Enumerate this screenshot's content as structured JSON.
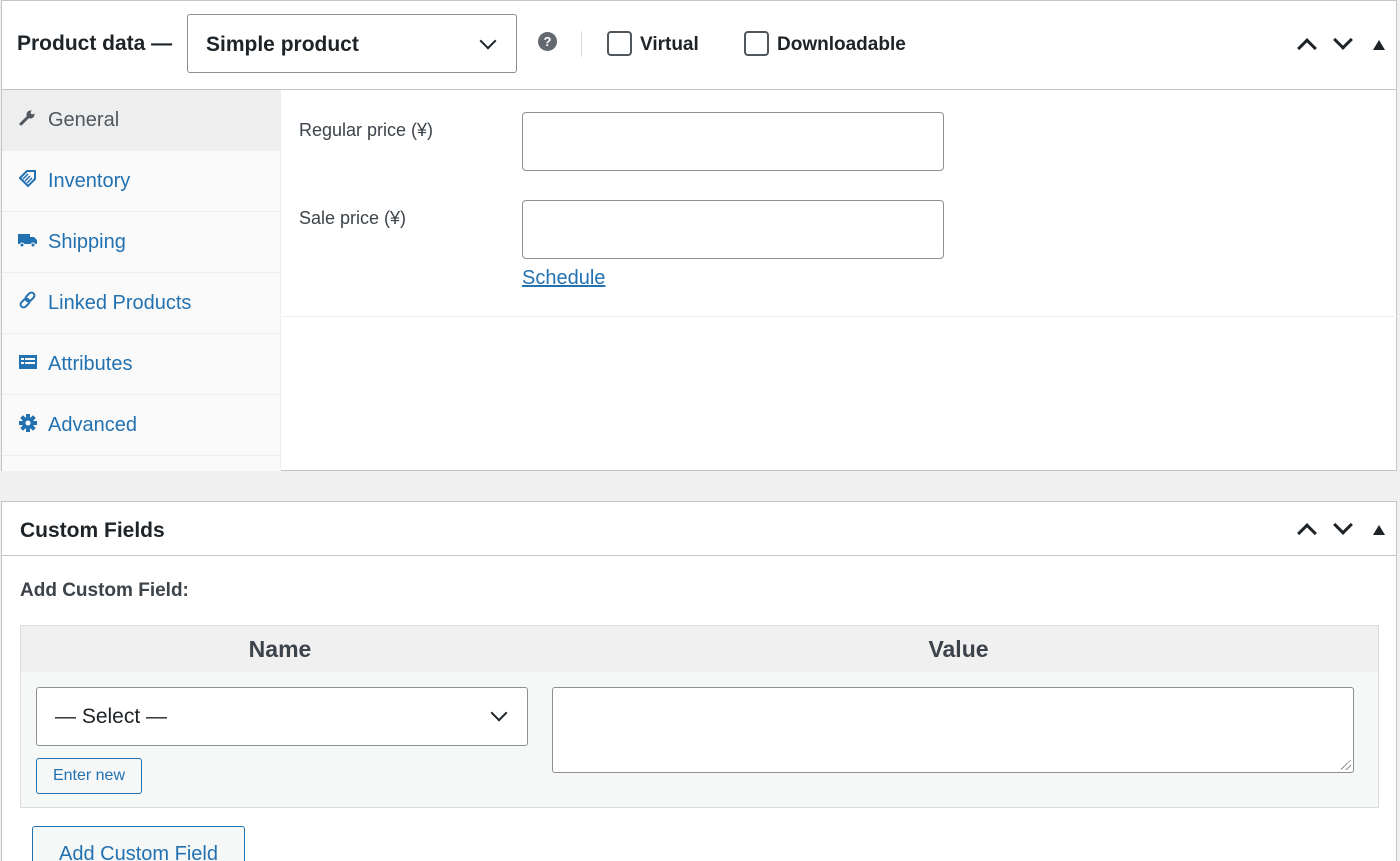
{
  "product_data": {
    "title": "Product data —",
    "product_type": "Simple product",
    "help_glyph": "?",
    "virtual_label": "Virtual",
    "virtual_checked": false,
    "downloadable_label": "Downloadable",
    "downloadable_checked": false,
    "tabs": [
      {
        "label": "General",
        "icon": "wrench-icon",
        "active": true
      },
      {
        "label": "Inventory",
        "icon": "tag-icon",
        "active": false
      },
      {
        "label": "Shipping",
        "icon": "truck-icon",
        "active": false
      },
      {
        "label": "Linked Products",
        "icon": "link-icon",
        "active": false
      },
      {
        "label": "Attributes",
        "icon": "list-icon",
        "active": false
      },
      {
        "label": "Advanced",
        "icon": "gear-icon",
        "active": false
      }
    ],
    "general": {
      "regular_price_label": "Regular price (¥)",
      "regular_price_value": "",
      "sale_price_label": "Sale price (¥)",
      "sale_price_value": "",
      "schedule_link": "Schedule"
    }
  },
  "custom_fields": {
    "title": "Custom Fields",
    "add_label": "Add Custom Field:",
    "name_header": "Name",
    "value_header": "Value",
    "name_select": "— Select —",
    "value": "",
    "enter_new_label": "Enter new",
    "add_button_label": "Add Custom Field"
  },
  "colors": {
    "link": "#2271b1",
    "text": "#1d2327",
    "border": "#c3c4c7",
    "background": "#f0f0f1"
  }
}
